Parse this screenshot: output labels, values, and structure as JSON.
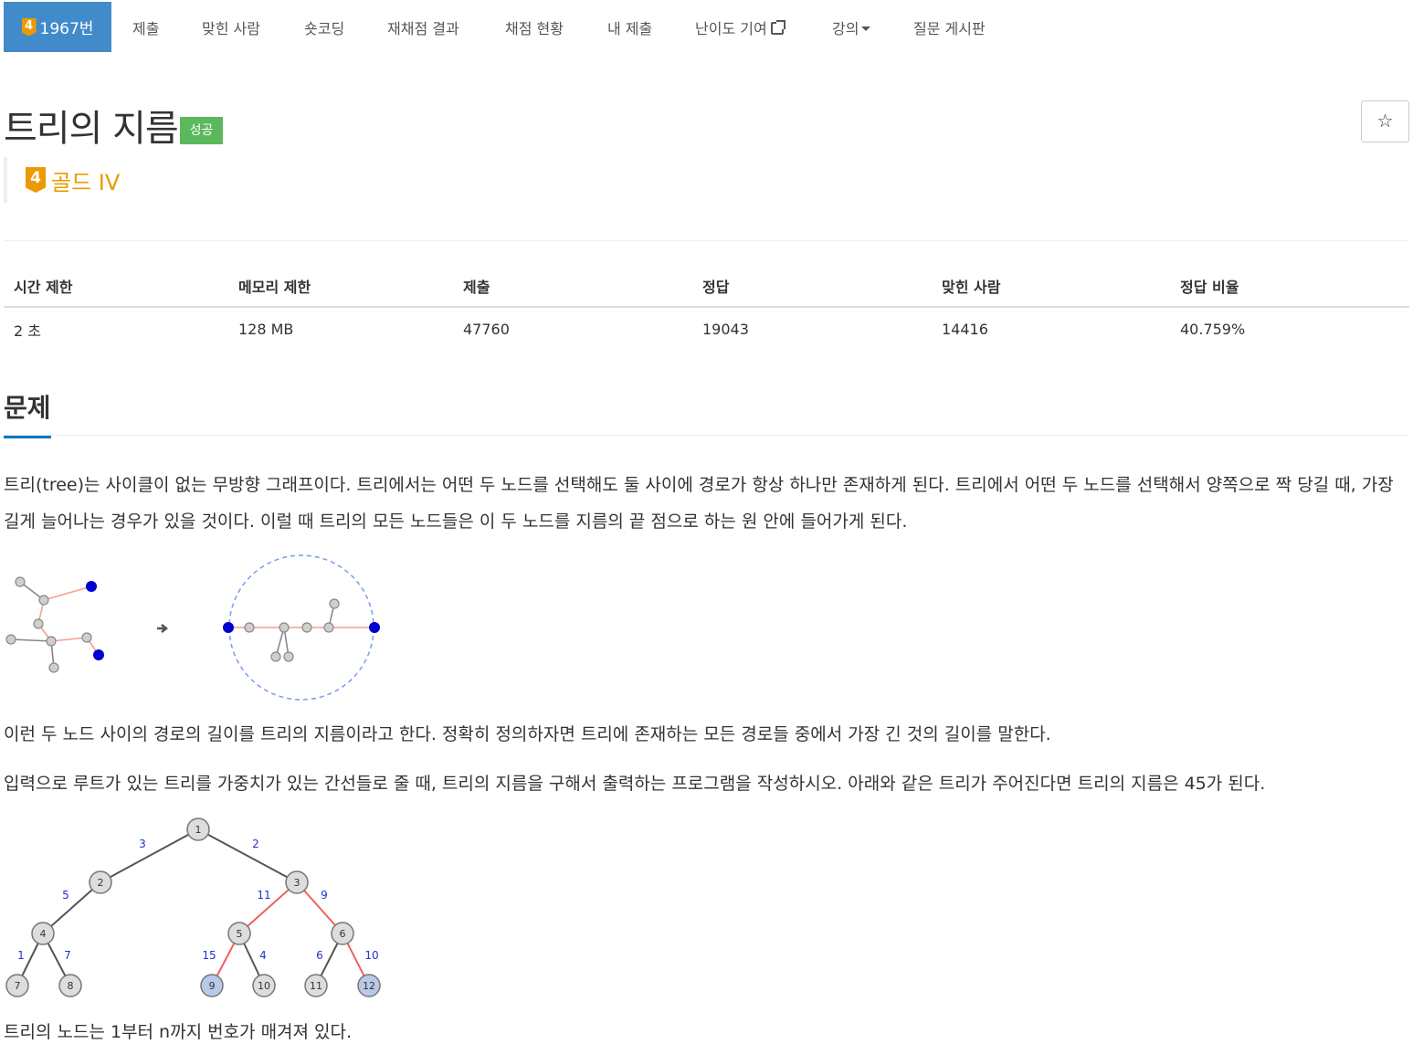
{
  "nav": {
    "problem_number": "1967번",
    "tier_digit": "4",
    "items": [
      "제출",
      "맞힌 사람",
      "숏코딩",
      "재채점 결과",
      "채점 현황",
      "내 제출",
      "난이도 기여",
      "강의",
      "질문 게시판"
    ]
  },
  "problem": {
    "title": "트리의 지름",
    "status": "성공",
    "tier_digit": "4",
    "tier_name": "골드 IV",
    "star": "☆"
  },
  "info": {
    "headers": [
      "시간 제한",
      "메모리 제한",
      "제출",
      "정답",
      "맞힌 사람",
      "정답 비율"
    ],
    "values": [
      "2 초",
      "128 MB",
      "47760",
      "19043",
      "14416",
      "40.759%"
    ]
  },
  "section": {
    "title": "문제",
    "para1": "트리(tree)는 사이클이 없는 무방향 그래프이다. 트리에서는 어떤 두 노드를 선택해도 둘 사이에 경로가 항상 하나만 존재하게 된다. 트리에서 어떤 두 노드를 선택해서 양쪽으로 짝 당길 때, 가장 길게 늘어나는 경우가 있을 것이다. 이럴 때 트리의 모든 노드들은 이 두 노드를 지름의 끝 점으로 하는 원 안에 들어가게 된다.",
    "para2": "이런 두 노드 사이의 경로의 길이를 트리의 지름이라고 한다. 정확히 정의하자면 트리에 존재하는 모든 경로들 중에서 가장 긴 것의 길이를 말한다.",
    "para3": "입력으로 루트가 있는 트리를 가중치가 있는 간선들로 줄 때, 트리의 지름을 구해서 출력하는 프로그램을 작성하시오. 아래와 같은 트리가 주어진다면 트리의 지름은 45가 된다.",
    "para4": "트리의 노드는 1부터 n까지 번호가 매겨져 있다."
  },
  "tree_figure": {
    "nodes": [
      "1",
      "2",
      "3",
      "4",
      "5",
      "6",
      "7",
      "8",
      "9",
      "10",
      "11",
      "12"
    ],
    "edge_weights": [
      "3",
      "2",
      "5",
      "11",
      "9",
      "1",
      "7",
      "15",
      "4",
      "6",
      "10"
    ],
    "colors": {
      "highlight_edge": "#f06060",
      "normal_edge": "#555555",
      "highlight_node": "#b9c9e8",
      "normal_node": "#dddddd",
      "weight_label": "#2233cc"
    }
  },
  "colors": {
    "nav_active": "#428bca",
    "success": "#5cb85c",
    "gold": "#ec9a00",
    "section_underline": "#0076c0"
  }
}
